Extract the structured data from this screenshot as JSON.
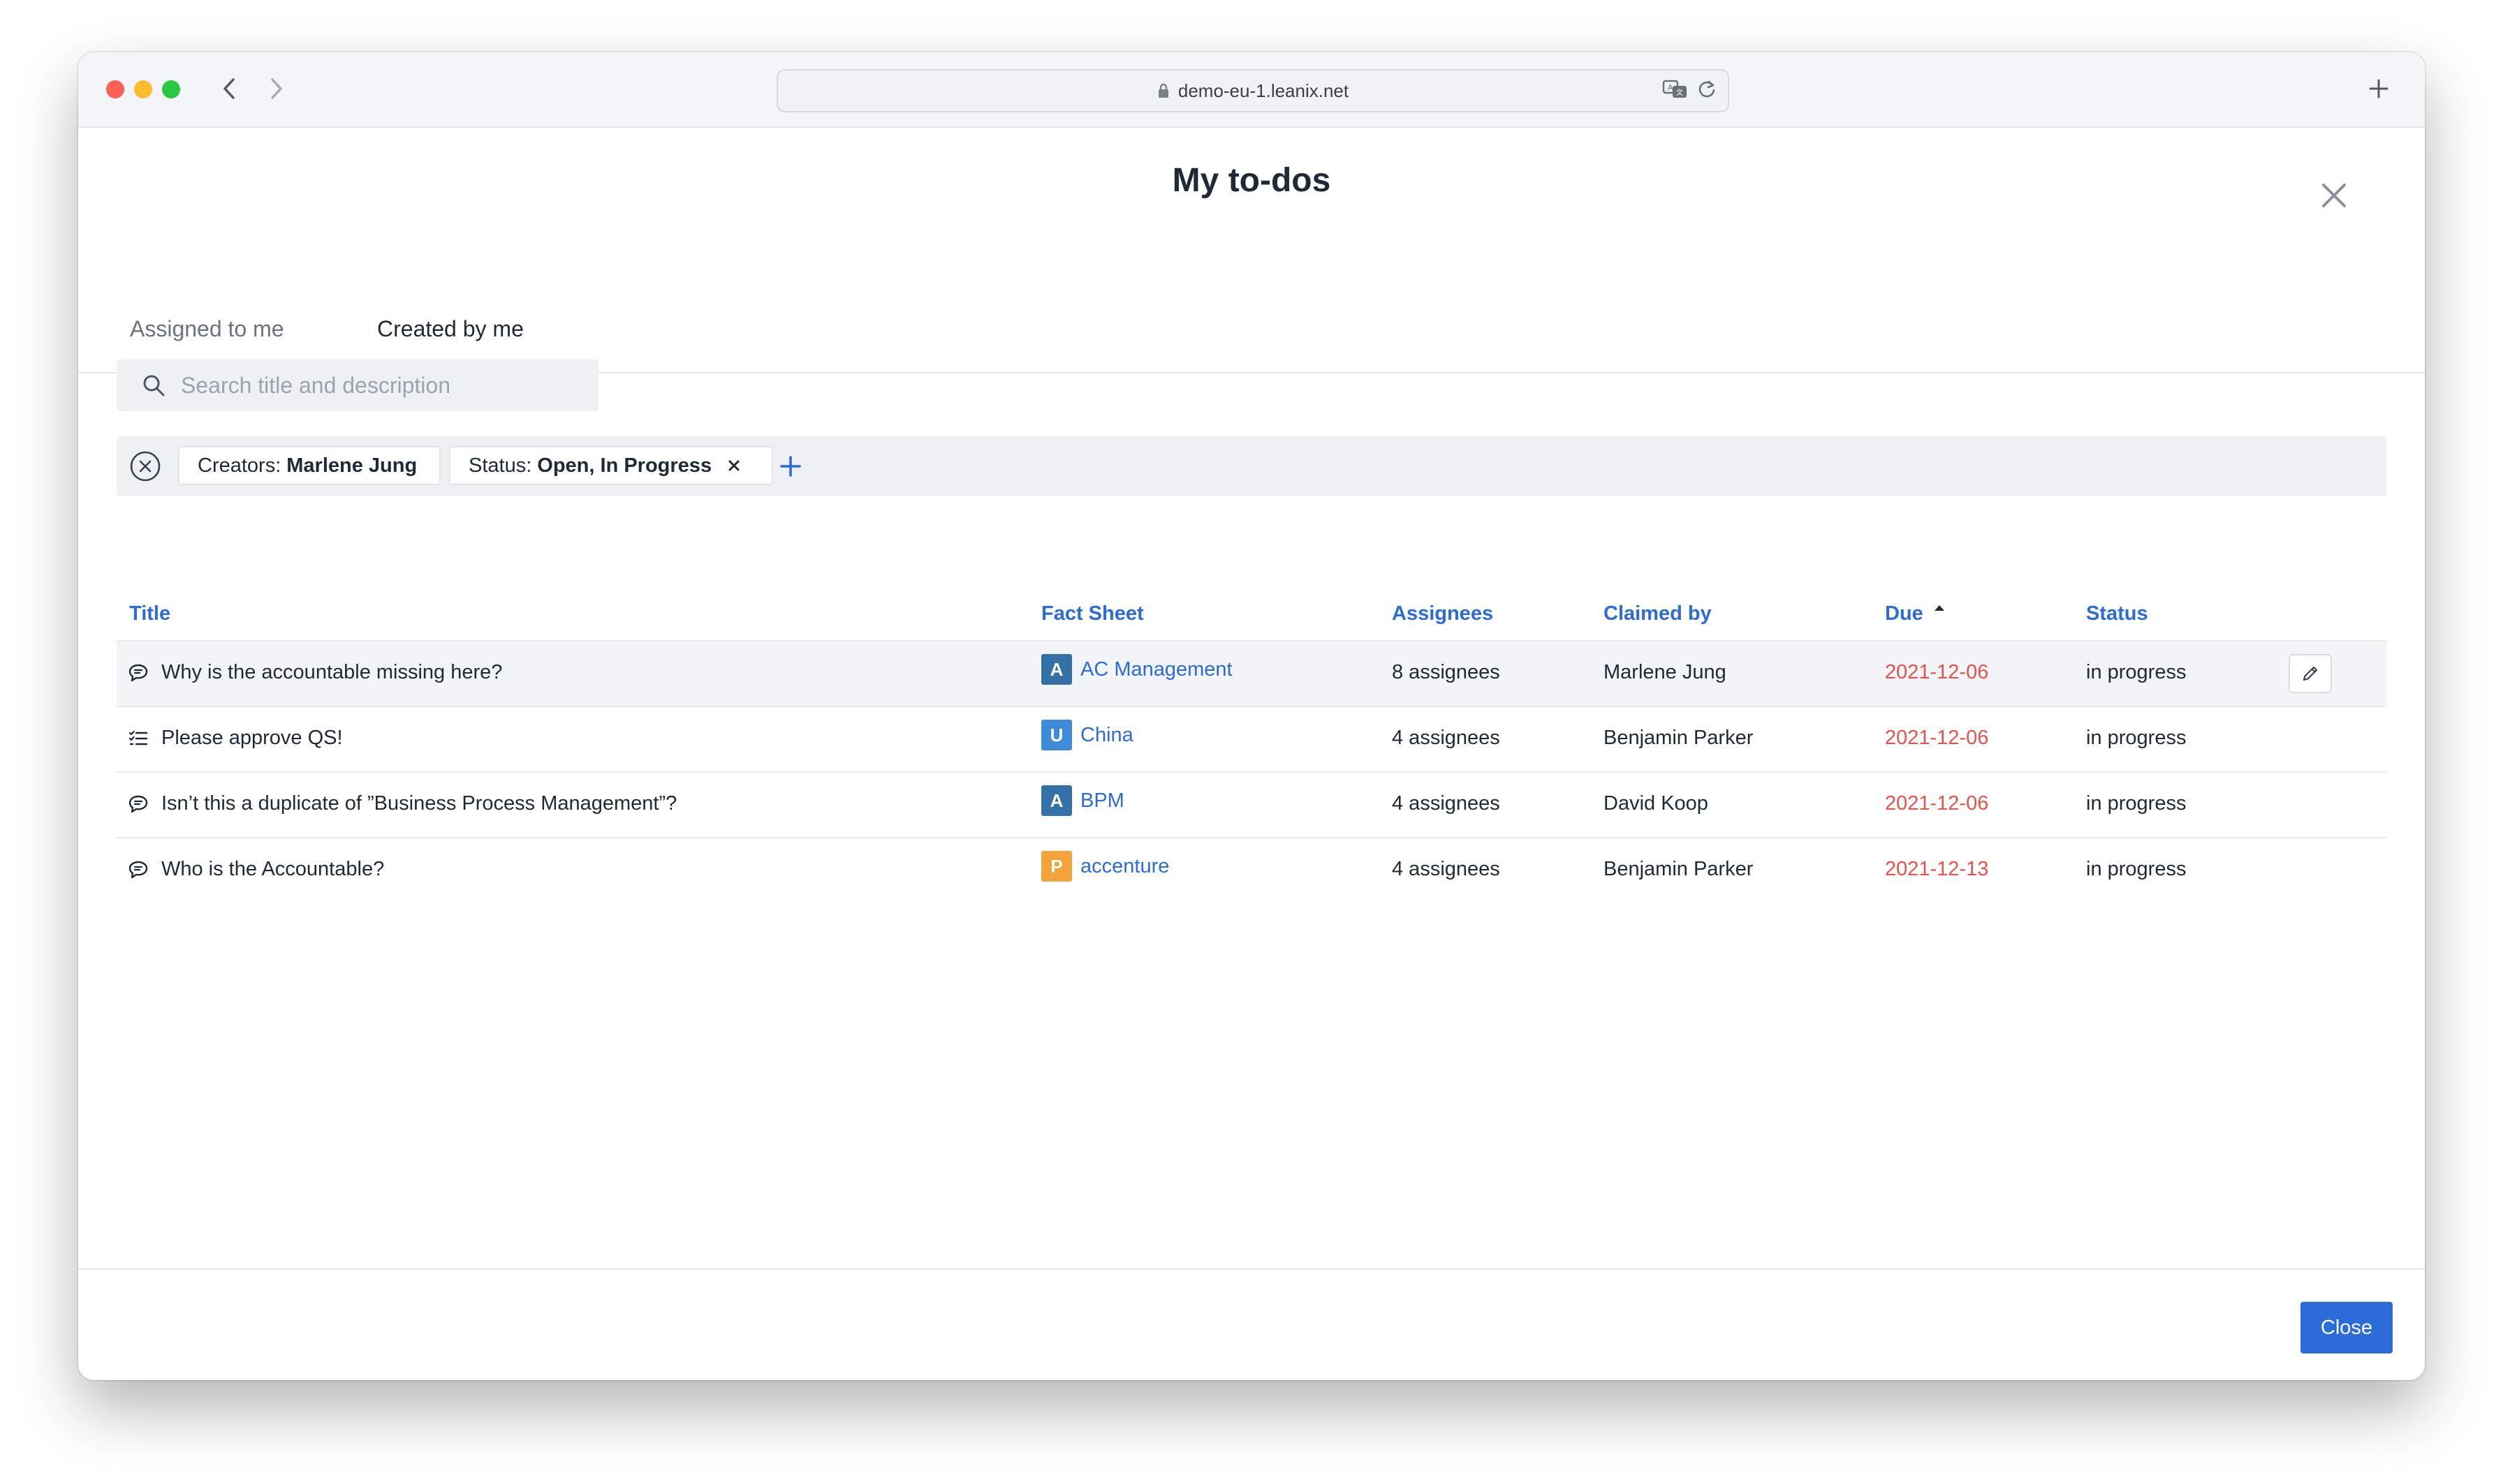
{
  "browser": {
    "url": "demo-eu-1.leanix.net"
  },
  "modal": {
    "title": "My to-dos",
    "close_label": "Close"
  },
  "tabs": [
    {
      "label": "Assigned to me",
      "active": false
    },
    {
      "label": "Created by me",
      "active": true
    }
  ],
  "search": {
    "placeholder": "Search title and description",
    "value": ""
  },
  "filters": [
    {
      "key": "Creators:",
      "values": "Marlene Jung"
    },
    {
      "key": "Status:",
      "values": "Open,  In Progress"
    }
  ],
  "table": {
    "columns": [
      "Title",
      "Fact Sheet",
      "Assignees",
      "Claimed by",
      "Due",
      "Status"
    ],
    "sort": {
      "column": "Due",
      "direction": "ascending"
    },
    "rows": [
      {
        "icon": "comment-icon",
        "title": "Why is the accountable missing here?",
        "fs_letter": "A",
        "fs_color": "#3471a8",
        "fact_sheet": "AC Management",
        "assignees": "8 assignees",
        "claimed_by": "Marlene Jung",
        "due": "2021-12-06",
        "status": "in progress",
        "highlighted": true
      },
      {
        "icon": "checklist-icon",
        "title": "Please approve QS!",
        "fs_letter": "U",
        "fs_color": "#3f8bdb",
        "fact_sheet": "China",
        "assignees": "4 assignees",
        "claimed_by": "Benjamin Parker",
        "due": "2021-12-06",
        "status": "in progress",
        "highlighted": false
      },
      {
        "icon": "comment-icon",
        "title": "Isn’t this a duplicate of ”Business Process Management”?",
        "fs_letter": "A",
        "fs_color": "#3471a8",
        "fact_sheet": "BPM",
        "assignees": "4 assignees",
        "claimed_by": "David Koop",
        "due": "2021-12-06",
        "status": "in progress",
        "highlighted": false
      },
      {
        "icon": "comment-icon",
        "title": "Who is the Accountable?",
        "fs_letter": "P",
        "fs_color": "#f2a43a",
        "fact_sheet": "accenture",
        "assignees": "4 assignees",
        "claimed_by": "Benjamin Parker",
        "due": "2021-12-13",
        "status": "in progress",
        "highlighted": false
      }
    ]
  },
  "colors": {
    "accent": "#2b6cd8",
    "due_overdue": "#e5534b"
  }
}
